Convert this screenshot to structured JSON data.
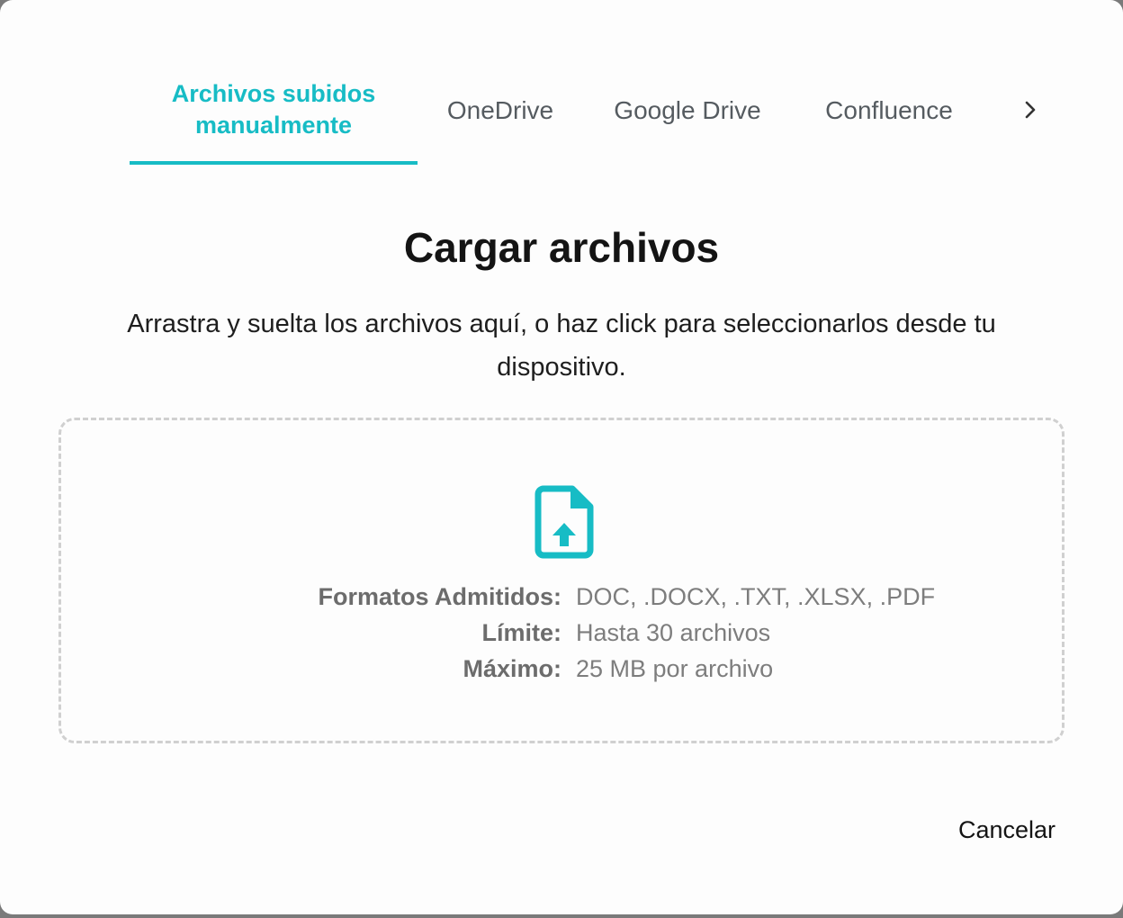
{
  "tabs": {
    "manual_line1": "Archivos subidos",
    "manual_line2": "manualmente",
    "onedrive": "OneDrive",
    "google_drive": "Google Drive",
    "confluence": "Confluence",
    "next_icon": "chevron-right-icon",
    "active_color": "#17bcc5"
  },
  "main": {
    "title": "Cargar archivos",
    "subtitle": "Arrastra y suelta los archivos aquí, o haz click para seleccionarlos desde tu dispositivo."
  },
  "dropzone": {
    "icon": "file-upload-icon",
    "rows": [
      {
        "label": "Formatos Admitidos:",
        "value": "DOC, .DOCX, .TXT, .XLSX, .PDF"
      },
      {
        "label": "Límite:",
        "value": "Hasta 30 archivos"
      },
      {
        "label": "Máximo:",
        "value": "25 MB por archivo"
      }
    ]
  },
  "footer": {
    "cancel_label": "Cancelar"
  }
}
